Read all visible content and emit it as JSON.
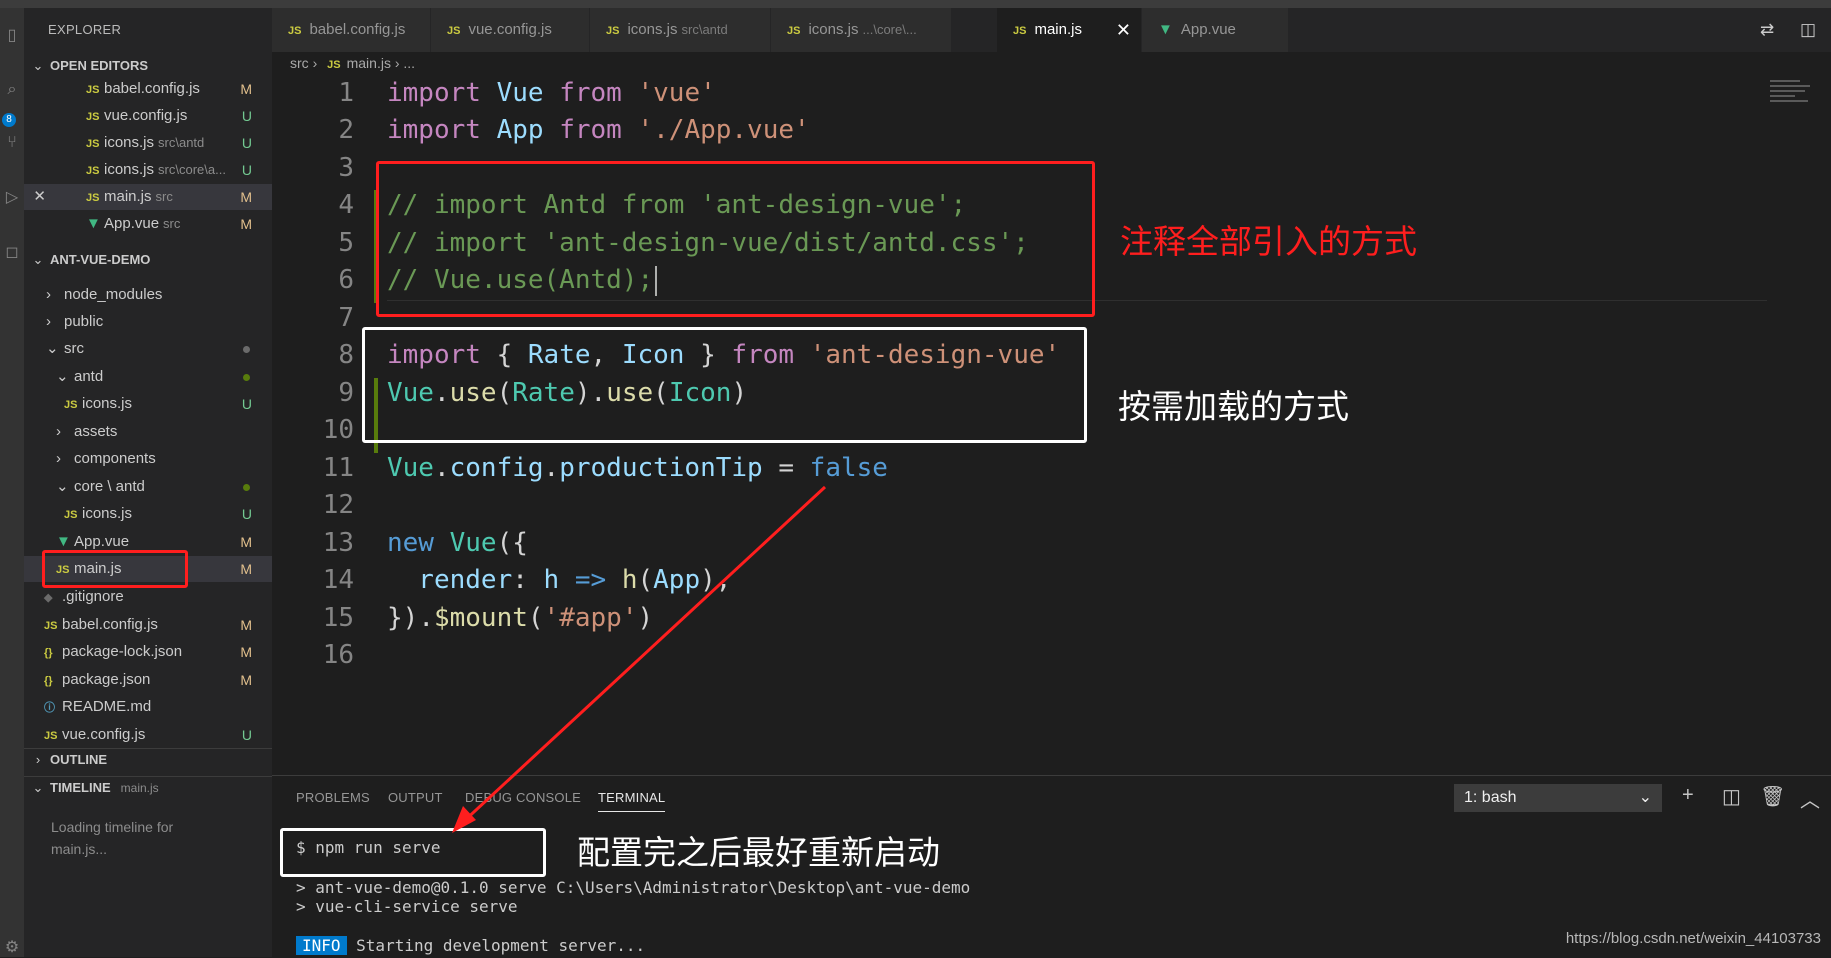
{
  "sidebar": {
    "title": "EXPLORER",
    "open_editors": {
      "header": "OPEN EDITORS",
      "items": [
        {
          "name": "babel.config.js",
          "desc": "",
          "status": "M"
        },
        {
          "name": "vue.config.js",
          "desc": "",
          "status": "U"
        },
        {
          "name": "icons.js",
          "desc": "src\\antd",
          "status": "U"
        },
        {
          "name": "icons.js",
          "desc": "src\\core\\a...",
          "status": "U"
        },
        {
          "name": "main.js",
          "desc": "src",
          "status": "M"
        },
        {
          "name": "App.vue",
          "desc": "src",
          "status": "M"
        }
      ]
    },
    "project": {
      "header": "ANT-VUE-DEMO",
      "items": [
        {
          "label": "node_modules"
        },
        {
          "label": "public"
        },
        {
          "label": "src"
        },
        {
          "label": "antd"
        },
        {
          "label": "icons.js",
          "status": "U"
        },
        {
          "label": "assets"
        },
        {
          "label": "components"
        },
        {
          "label": "core \\ antd"
        },
        {
          "label": "icons.js",
          "status": "U"
        },
        {
          "label": "App.vue",
          "status": "M"
        },
        {
          "label": "main.js",
          "status": "M"
        },
        {
          "label": ".gitignore"
        },
        {
          "label": "babel.config.js",
          "status": "M"
        },
        {
          "label": "package-lock.json",
          "status": "M"
        },
        {
          "label": "package.json",
          "status": "M"
        },
        {
          "label": "README.md"
        },
        {
          "label": "vue.config.js",
          "status": "U"
        }
      ]
    },
    "outline": {
      "header": "OUTLINE"
    },
    "timeline": {
      "header": "TIMELINE",
      "file": "main.js",
      "loading": "Loading timeline for main.js..."
    },
    "activity_badge": "8"
  },
  "tabs": [
    {
      "name": "babel.config.js",
      "desc": ""
    },
    {
      "name": "vue.config.js",
      "desc": ""
    },
    {
      "name": "icons.js",
      "desc": "src\\antd"
    },
    {
      "name": "icons.js",
      "desc": "...\\core\\..."
    },
    {
      "name": "main.js",
      "desc": "",
      "close": "✕"
    },
    {
      "name": "App.vue",
      "desc": ""
    }
  ],
  "breadcrumb": {
    "seg1": "src",
    "seg2": "main.js",
    "seg3": "..."
  },
  "editor": {
    "line_numbers": [
      "1",
      "2",
      "3",
      "4",
      "5",
      "6",
      "7",
      "8",
      "9",
      "10",
      "11",
      "12",
      "13",
      "14",
      "15",
      "16"
    ],
    "lines": {
      "l1": [
        "import",
        " Vue ",
        "from",
        " 'vue'"
      ],
      "l2": [
        "import",
        " App ",
        "from",
        " './App.vue'"
      ],
      "l4": "// import Antd from 'ant-design-vue';",
      "l5": "// import 'ant-design-vue/dist/antd.css';",
      "l6": "// Vue.use(Antd);",
      "l8": [
        "import",
        " { ",
        "Rate",
        ", ",
        "Icon",
        " } ",
        "from",
        " 'ant-design-vue'"
      ],
      "l9": [
        "Vue",
        ".",
        "use",
        "(",
        "Rate",
        ").",
        "use",
        "(",
        "Icon",
        ")"
      ],
      "l11": [
        "Vue",
        ".",
        "config",
        ".",
        "productionTip",
        " = ",
        "false"
      ],
      "l13": [
        "new",
        " ",
        "Vue",
        "({"
      ],
      "l14": [
        "  render",
        ": ",
        "h",
        " => ",
        "h",
        "(",
        "App",
        "),"
      ],
      "l15": [
        "})",
        ".",
        "$mount",
        "(",
        "'#app'",
        ")"
      ]
    }
  },
  "annotations": {
    "comment_all": "注释全部引入的方式",
    "on_demand": "按需加载的方式",
    "restart": "配置完之后最好重新启动"
  },
  "panel": {
    "tabs": [
      "PROBLEMS",
      "OUTPUT",
      "DEBUG CONSOLE",
      "TERMINAL"
    ],
    "active_tab": "TERMINAL",
    "terminal_select": "1: bash",
    "lines": {
      "cmd": "$ npm run serve",
      "out1": "> ant-vue-demo@0.1.0 serve C:\\Users\\Administrator\\Desktop\\ant-vue-demo",
      "out2": "> vue-cli-service serve",
      "info_badge": "INFO",
      "info_text": " Starting development server..."
    }
  },
  "watermark": "https://blog.csdn.net/weixin_44103733",
  "colors": {
    "accent": "#007acc",
    "annotation_red": "#ff1e1e",
    "modified": "#e2c08d",
    "untracked": "#73c991"
  }
}
